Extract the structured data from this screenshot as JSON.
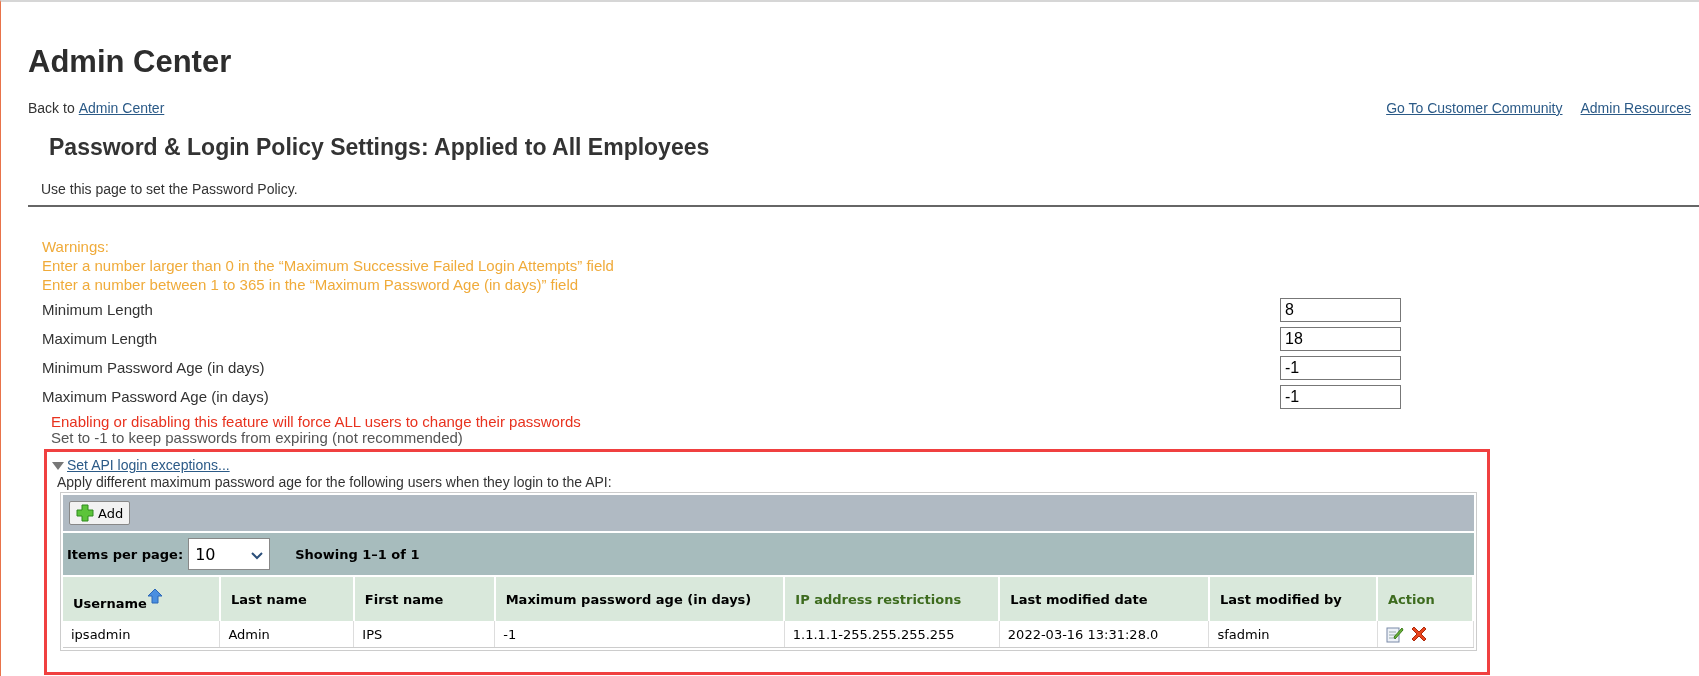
{
  "title": "Admin Center",
  "nav": {
    "back_prefix": "Back to",
    "back_link": "Admin Center",
    "links": [
      "Go To Customer Community",
      "Admin Resources"
    ]
  },
  "section": {
    "heading": "Password & Login Policy Settings: Applied to All Employees",
    "description": "Use this page to set the Password Policy."
  },
  "warnings": {
    "title": "Warnings:",
    "items": [
      "Enter a number larger than 0 in the “Maximum Successive Failed Login Attempts” field",
      "Enter a number between 1 to 365 in the “Maximum Password Age (in days)” field"
    ]
  },
  "fields": [
    {
      "label": "Minimum Length",
      "value": "8"
    },
    {
      "label": "Maximum Length",
      "value": "18"
    },
    {
      "label": "Minimum Password Age (in days)",
      "value": "-1"
    },
    {
      "label": "Maximum Password Age (in days)",
      "value": "-1"
    }
  ],
  "notice": "Enabling or disabling this feature will force ALL users to change their passwords",
  "hint": "Set to -1 to keep passwords from expiring (not recommended)",
  "api_exceptions": {
    "highlighted": true,
    "expanded": true,
    "link": "Set API login exceptions...",
    "description": "Apply different maximum password age for the following users when they login to the API:",
    "add_button": "Add",
    "items_per_page_label": "Items per page:",
    "items_per_page": "10",
    "showing": "Showing 1–1 of 1",
    "columns": [
      {
        "label": "Username",
        "sortable": true,
        "sorted": true
      },
      {
        "label": "Last name",
        "sortable": true,
        "sorted": false
      },
      {
        "label": "First name",
        "sortable": true,
        "sorted": false
      },
      {
        "label": "Maximum password age (in days)",
        "sortable": true,
        "sorted": false
      },
      {
        "label": "IP address restrictions",
        "sortable": false,
        "sorted": false
      },
      {
        "label": "Last modified date",
        "sortable": true,
        "sorted": false
      },
      {
        "label": "Last modified by",
        "sortable": true,
        "sorted": false
      },
      {
        "label": "Action",
        "sortable": false,
        "sorted": false
      }
    ],
    "rows": [
      {
        "cells": [
          "ipsadmin",
          "Admin",
          "IPS",
          "-1",
          "1.1.1.1-255.255.255.255",
          "2022-03-16 13:31:28.0",
          "sfadmin"
        ]
      }
    ]
  }
}
